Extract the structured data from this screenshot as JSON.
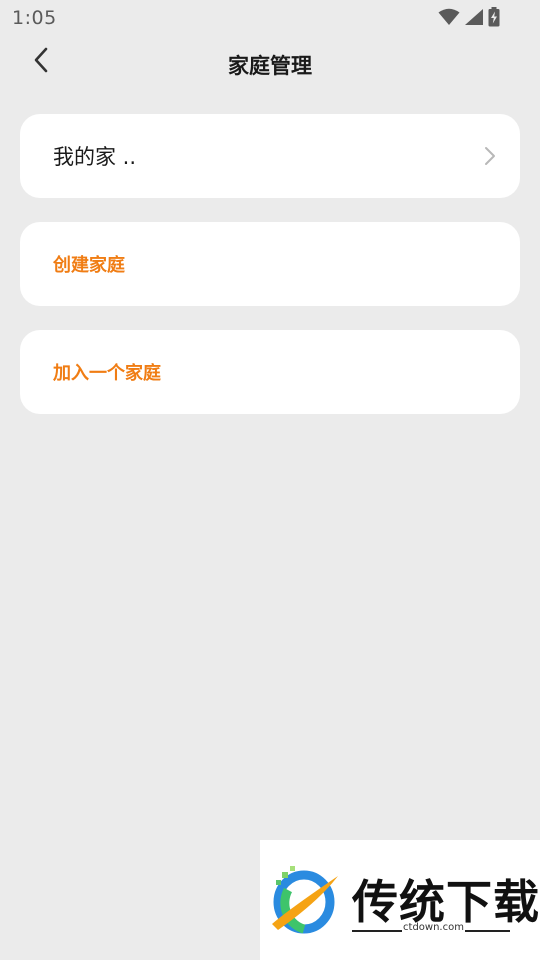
{
  "status_bar": {
    "time": "1:05",
    "icons": [
      "wifi-icon",
      "signal-icon",
      "battery-charging-icon"
    ]
  },
  "header": {
    "back_icon": "chevron-left-icon",
    "title": "家庭管理"
  },
  "homes": [
    {
      "label": "我的家 ..",
      "icon": "chevron-right-icon"
    }
  ],
  "actions": {
    "create_label": "创建家庭",
    "join_label": "加入一个家庭"
  },
  "watermark": {
    "brand": "传统下载",
    "url": "ctdown.com"
  },
  "colors": {
    "background": "#ebebeb",
    "card": "#ffffff",
    "accent": "#f07d14",
    "text_primary": "#1a1a1a"
  }
}
